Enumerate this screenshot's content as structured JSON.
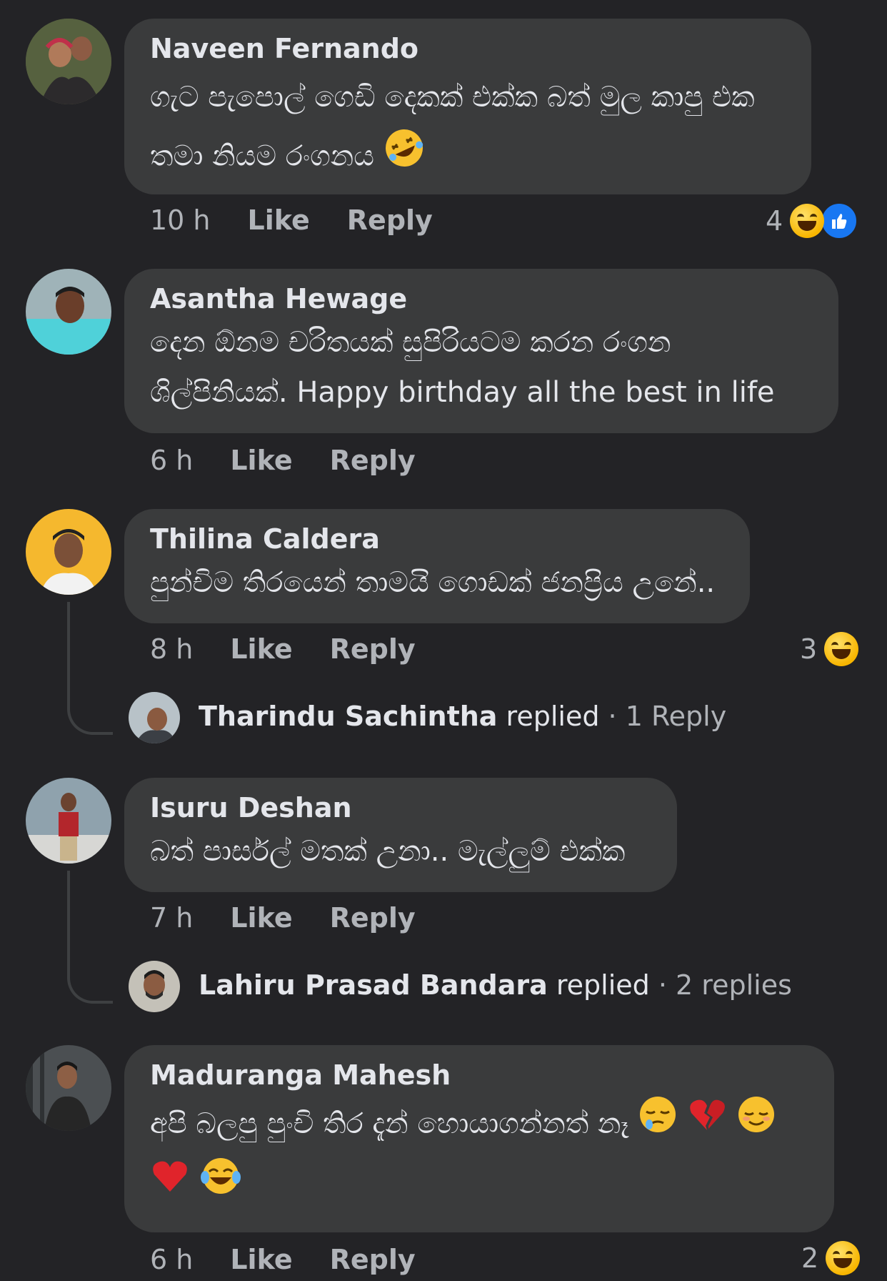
{
  "comments": [
    {
      "author": "Naveen Fernando",
      "line1": "ගැට පැපොල් ගෙඩි දෙකක් එක්ක බත් මුල කාපු එක",
      "line2": "තමා නියම රංගනය",
      "line2_emoji": "rolling-on-floor-laughing-emoji",
      "time": "10 h",
      "like": "Like",
      "reply": "Reply",
      "reaction_count": "4",
      "reactions": [
        "haha-icon",
        "like-icon"
      ]
    },
    {
      "author": "Asantha Hewage",
      "line1": "දෙන ඕනම චරිතයක් සුපිරියටම කරන රංගන",
      "line2": "ශිල්පිනියක්. Happy birthday all the best in life",
      "time": "6 h",
      "like": "Like",
      "reply": "Reply"
    },
    {
      "author": "Thilina Caldera",
      "line1": "පුන්චිම තිරයෙන් තාමයි ගොඩක් ජනප්‍රිය උනේ..",
      "time": "8 h",
      "like": "Like",
      "reply": "Reply",
      "reaction_count": "3",
      "reactions": [
        "haha-icon"
      ],
      "replies": {
        "name": "Tharindu Sachintha",
        "verb": "replied",
        "sep": " · ",
        "count": "1 Reply"
      }
    },
    {
      "author": "Isuru Deshan",
      "line1": "බත් පාර්සල් මතක් උනා.. මැල්ලුම් එක්ක",
      "time": "7 h",
      "like": "Like",
      "reply": "Reply",
      "replies": {
        "name": "Lahiru Prasad Bandara",
        "verb": "replied",
        "sep": " · ",
        "count": "2 replies"
      }
    },
    {
      "author": "Maduranga Mahesh",
      "line1": "අපි බලපු පුංචි තිර දැන් හොයාගන්නත් නෑ",
      "line1_emojis": [
        "sleepy-face-emoji",
        "broken-heart-emoji",
        "relieved-face-emoji"
      ],
      "line2_emojis": [
        "red-heart-emoji",
        "tears-of-joy-emoji"
      ],
      "time": "6 h",
      "like": "Like",
      "reply": "Reply",
      "reaction_count": "2",
      "reactions": [
        "haha-icon"
      ]
    }
  ],
  "colors": {
    "background": "#232326",
    "bubble": "#3a3b3c",
    "text": "#e4e6eb",
    "meta": "#b0b3b8",
    "like_blue": "#1877f2",
    "haha_yellow": "#f7b500"
  }
}
